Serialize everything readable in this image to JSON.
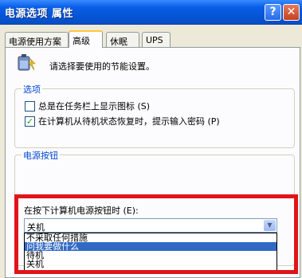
{
  "window": {
    "title": "电源选项 属性",
    "help_glyph": "?",
    "close_glyph": "✕"
  },
  "tabs": [
    {
      "label": "电源使用方案",
      "active": false
    },
    {
      "label": "高级",
      "active": true
    },
    {
      "label": "休眠",
      "active": false
    },
    {
      "label": "UPS",
      "active": false
    }
  ],
  "intro_text": "请选择要使用的节能设置。",
  "options_group": {
    "legend": "选项",
    "show_icon": {
      "label": "总是在任务栏上显示图标 (S)",
      "checked": false
    },
    "prompt_password": {
      "label": "在计算机从待机状态恢复时，提示输入密码 (P)",
      "checked": true,
      "mark": "✓"
    }
  },
  "power_group": {
    "legend": "电源按钮",
    "dropdown_label": "在按下计算机电源按钮时 (E):",
    "dropdown_value": "关机",
    "dropdown_arrow": "▼",
    "options": [
      "不采取任何措施",
      "问我要做什么",
      "待机",
      "关机"
    ],
    "selected_option": "问我要做什么"
  },
  "colors": {
    "title_bar": "#0554D4",
    "highlight": "#316AC5",
    "red_frame": "#E0141A",
    "legend_text": "#0046D5"
  }
}
